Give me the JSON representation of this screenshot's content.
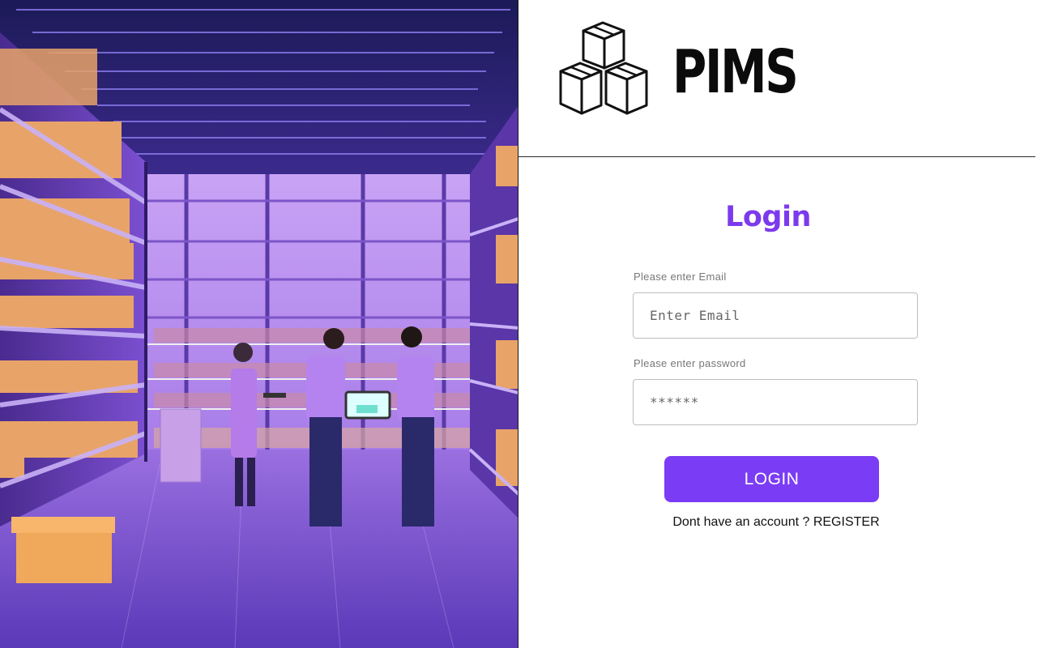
{
  "brand": {
    "name": "PIMS",
    "logo_icon": "stacked-boxes-icon"
  },
  "illustration": {
    "description_icon": "warehouse-illustration",
    "colors": {
      "accent": "#7b3cf5",
      "shelf_glow": "#b98cf6",
      "box": "#e8a368"
    }
  },
  "login": {
    "title": "Login",
    "email_label": "Please enter Email",
    "email_placeholder": "Enter Email",
    "password_label": "Please enter password",
    "password_placeholder": "******",
    "button_label": "LOGIN",
    "register_prompt": "Dont have an account ? ",
    "register_link": "REGISTER"
  },
  "colors": {
    "primary": "#7b3cf5",
    "title": "#7c3aed"
  }
}
